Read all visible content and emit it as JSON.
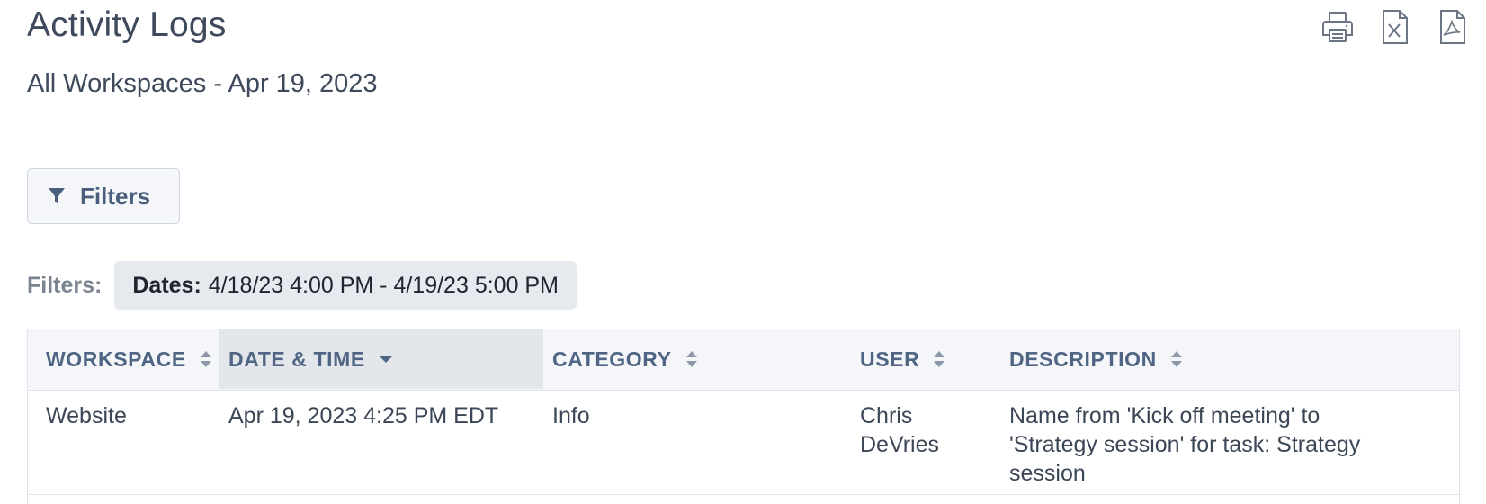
{
  "header": {
    "title": "Activity Logs",
    "subtitle": "All Workspaces - Apr 19, 2023"
  },
  "export": {
    "icons": [
      "printer-icon",
      "excel-icon",
      "pdf-icon"
    ]
  },
  "filters_button": {
    "label": "Filters",
    "icon": "filter-funnel-icon"
  },
  "active_filters": {
    "prefix": "Filters:",
    "chips": [
      {
        "key": "Dates:",
        "value": "4/18/23 4:00 PM - 4/19/23 5:00 PM"
      }
    ]
  },
  "table": {
    "columns": [
      {
        "label": "WORKSPACE",
        "sort": "none"
      },
      {
        "label": "DATE & TIME",
        "sort": "descending"
      },
      {
        "label": "CATEGORY",
        "sort": "none"
      },
      {
        "label": "USER",
        "sort": "none"
      },
      {
        "label": "DESCRIPTION",
        "sort": "none"
      }
    ],
    "rows": [
      {
        "workspace": "Website",
        "datetime": "Apr 19, 2023 4:25 PM EDT",
        "category": "Info",
        "user_line1": "Chris",
        "user_line2": "DeVries",
        "desc_line1": "Name from 'Kick off meeting' to",
        "desc_line2": "'Strategy session' for task: Strategy",
        "desc_line3": "session"
      }
    ]
  },
  "colors": {
    "header_bg": "#f4f6f9",
    "sorted_header_bg": "#e3e7ec",
    "header_text": "#4f6583",
    "chip_bg": "#e6eaef"
  }
}
